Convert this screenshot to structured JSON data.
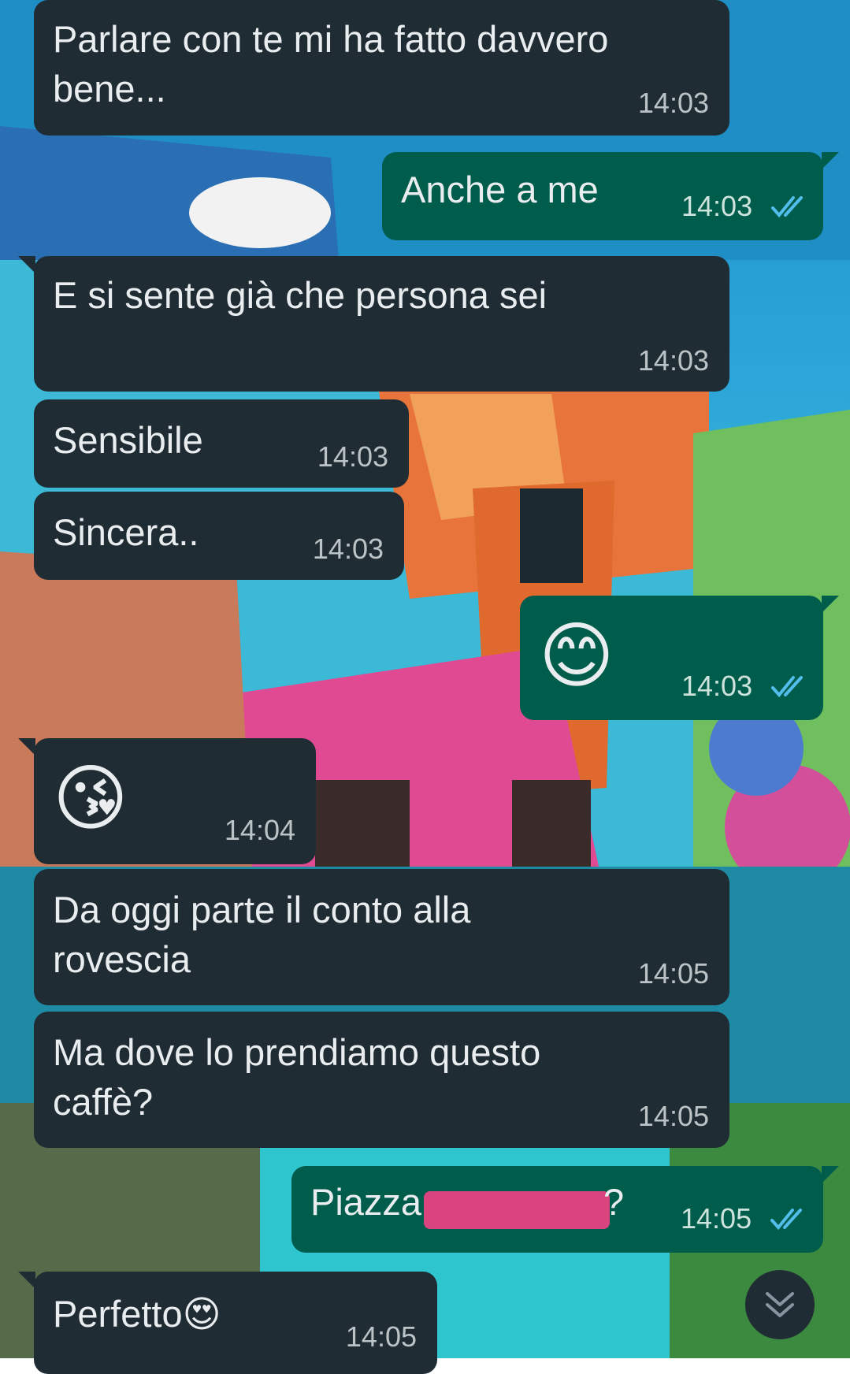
{
  "colors": {
    "incoming_bubble": "#202c33",
    "outgoing_bubble": "#005c4b",
    "read_ticks": "#53bdeb"
  },
  "messages": [
    {
      "direction": "in",
      "text": "Parlare con te mi ha fatto davvero\nbene...",
      "time": "14:03"
    },
    {
      "direction": "out",
      "text": "Anche a me",
      "time": "14:03",
      "status": "read-double-check-icon"
    },
    {
      "direction": "in",
      "text": "E si sente già che persona sei",
      "time": "14:03"
    },
    {
      "direction": "in",
      "text": "Sensibile",
      "time": "14:03"
    },
    {
      "direction": "in",
      "text": "Sincera..",
      "time": "14:03"
    },
    {
      "direction": "out",
      "text": "😊",
      "time": "14:03",
      "status": "read-double-check-icon"
    },
    {
      "direction": "in",
      "text": "😘",
      "time": "14:04"
    },
    {
      "direction": "in",
      "text": "Da oggi parte il conto alla\nrovescia",
      "time": "14:05"
    },
    {
      "direction": "in",
      "text": "Ma dove lo prendiamo questo\ncaffè?",
      "time": "14:05"
    },
    {
      "direction": "out",
      "text": "Piazza",
      "text_suffix": "?",
      "time": "14:05",
      "status": "read-double-check-icon",
      "redacted": true
    },
    {
      "direction": "in",
      "text": "Perfetto😍",
      "time": "14:05"
    }
  ],
  "scroll_button": {
    "icon": "double-chevron-down-icon"
  }
}
